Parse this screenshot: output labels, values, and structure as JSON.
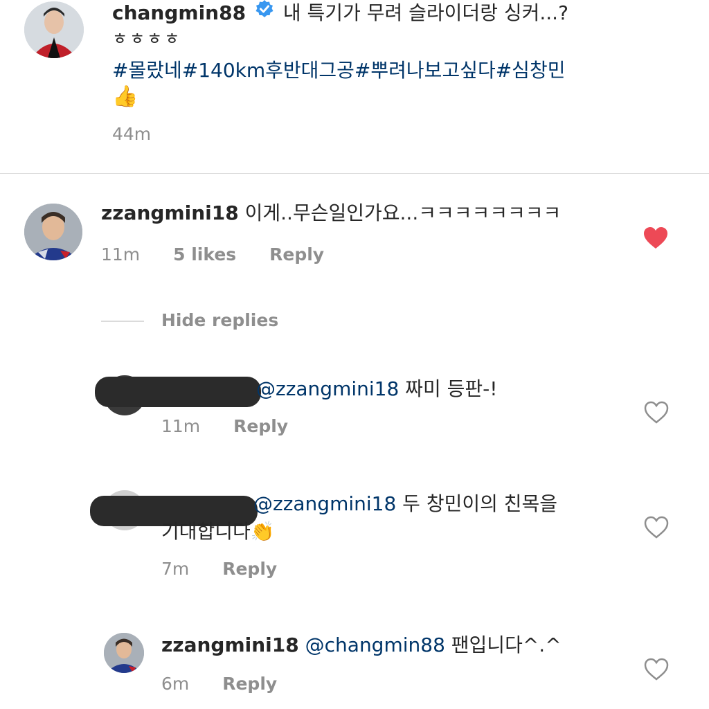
{
  "caption": {
    "username": "changmin88",
    "text_line1": "내 특기가 무려 슬라이더랑 싱커...?",
    "text_line2": "ㅎㅎㅎㅎ",
    "hashtags": "#몰랐네#140km후반대그공#뿌려나보고싶다#심창민",
    "emoji": "👍",
    "time": "44m"
  },
  "comment": {
    "username": "zzangmini18",
    "text": "이게..무슨일인가요...ㅋㅋㅋㅋㅋㅋㅋㅋ",
    "time": "11m",
    "likes": "5 likes",
    "reply": "Reply",
    "liked": true
  },
  "hide_replies": "Hide replies",
  "replies": [
    {
      "mention": "@zzangmini18",
      "text": " 짜미 등판-!",
      "time": "11m",
      "reply": "Reply"
    },
    {
      "mention": "@zzangmini18",
      "text_line1": " 두 창민이의 친목을",
      "text_line2": "기대합니다",
      "emoji": "👏",
      "time": "7m",
      "reply": "Reply"
    },
    {
      "username": "zzangmini18",
      "mention": "@changmin88",
      "text": " 팬입니다^.^",
      "time": "6m",
      "reply": "Reply"
    }
  ],
  "colors": {
    "text": "#262626",
    "muted": "#8e8e8e",
    "link": "#003569",
    "like_red": "#ed4956",
    "verified_blue": "#3897f0"
  }
}
